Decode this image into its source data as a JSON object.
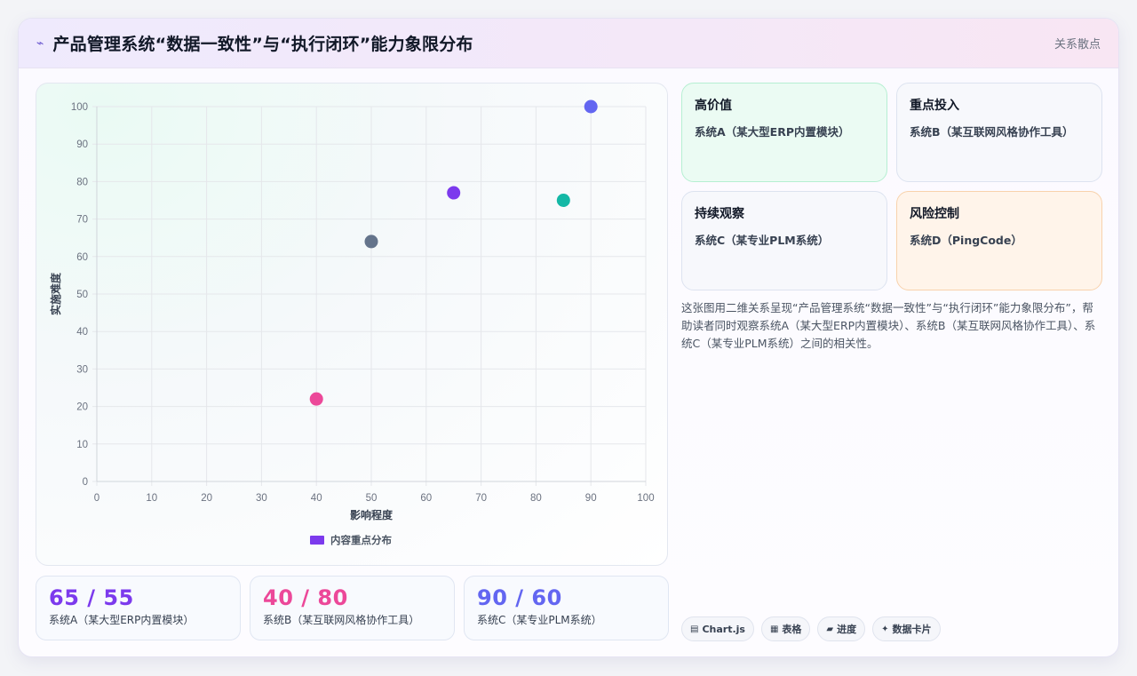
{
  "header": {
    "title": "产品管理系统“数据一致性”与“执行闭环”能力象限分布",
    "tag": "关系散点"
  },
  "chart_data": {
    "type": "scatter",
    "xlabel": "影响程度",
    "ylabel": "实施难度",
    "xlim": [
      0,
      100
    ],
    "ylim": [
      0,
      100
    ],
    "xticks": [
      "0",
      "10",
      "20",
      "30",
      "40",
      "50",
      "60",
      "70",
      "80",
      "90",
      "100"
    ],
    "yticks": [
      "0",
      "10",
      "20",
      "30",
      "40",
      "50",
      "60",
      "70",
      "80",
      "90",
      "100"
    ],
    "grid": true,
    "legend": {
      "position": "bottom",
      "label": "内容重点分布",
      "color": "#7c3aed"
    },
    "points": [
      {
        "x": 40,
        "y": 22,
        "color": "#ec4899"
      },
      {
        "x": 50,
        "y": 64,
        "color": "#64748b"
      },
      {
        "x": 65,
        "y": 77,
        "color": "#7c3aed"
      },
      {
        "x": 85,
        "y": 75,
        "color": "#14b8a6"
      },
      {
        "x": 90,
        "y": 100,
        "color": "#6366f1"
      }
    ]
  },
  "quadrants": [
    {
      "title": "高价值",
      "system": "系统A（某大型ERP内置模块）"
    },
    {
      "title": "重点投入",
      "system": "系统B（某互联网风格协作工具）"
    },
    {
      "title": "持续观察",
      "system": "系统C（某专业PLM系统）"
    },
    {
      "title": "风险控制",
      "system": "系统D（PingCode）"
    }
  ],
  "description": "这张图用二维关系呈现“产品管理系统“数据一致性”与“执行闭环”能力象限分布”，帮助读者同时观察系统A（某大型ERP内置模块）、系统B（某互联网风格协作工具）、系统C（某专业PLM系统）之间的相关性。",
  "stats": [
    {
      "value": "65 / 55",
      "label": "系统A（某大型ERP内置模块）"
    },
    {
      "value": "40 / 80",
      "label": "系统B（某互联网风格协作工具）"
    },
    {
      "value": "90 / 60",
      "label": "系统C（某专业PLM系统）"
    }
  ],
  "pills": [
    {
      "icon": "▤",
      "label": "Chart.js"
    },
    {
      "icon": "▦",
      "label": "表格"
    },
    {
      "icon": "▰",
      "label": "进度"
    },
    {
      "icon": "✦",
      "label": "数据卡片"
    }
  ]
}
